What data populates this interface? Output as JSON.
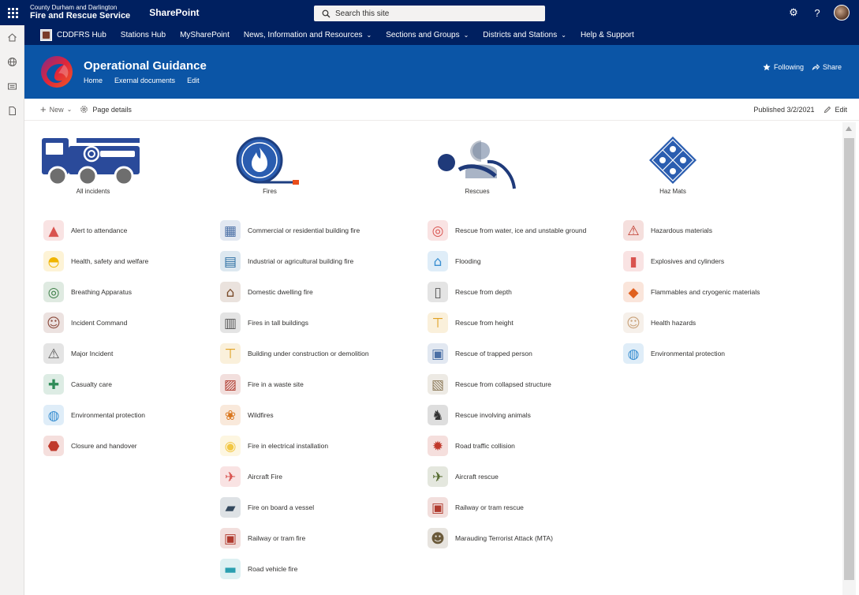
{
  "suite": {
    "org_line1": "County Durham and Darlington",
    "org_line2": "Fire and Rescue Service",
    "app_name": "SharePoint",
    "search_placeholder": "Search this site",
    "settings_glyph": "⚙",
    "help_glyph": "?"
  },
  "hubnav": {
    "items": [
      {
        "label": "CDDFRS Hub",
        "dropdown": false
      },
      {
        "label": "Stations Hub",
        "dropdown": false
      },
      {
        "label": "MySharePoint",
        "dropdown": false
      },
      {
        "label": "News, Information and Resources",
        "dropdown": true
      },
      {
        "label": "Sections and Groups",
        "dropdown": true
      },
      {
        "label": "Districts and Stations",
        "dropdown": true
      },
      {
        "label": "Help & Support",
        "dropdown": false
      }
    ]
  },
  "site": {
    "title": "Operational Guidance",
    "links": [
      "Home",
      "Exernal documents",
      "Edit"
    ],
    "following_label": "Following",
    "share_label": "Share"
  },
  "commandbar": {
    "new_label": "New",
    "page_details_label": "Page details",
    "published_label": "Published 3/2/2021",
    "edit_label": "Edit"
  },
  "columns": [
    {
      "heading": "All incidents",
      "heading_icon": "fire-engine-icon",
      "items": [
        {
          "label": "Alert to attendance",
          "icon": "alarm-light-icon"
        },
        {
          "label": "Health, safety and welfare",
          "icon": "hard-hat-icon"
        },
        {
          "label": "Breathing Apparatus",
          "icon": "gas-mask-icon"
        },
        {
          "label": "Incident Command",
          "icon": "team-icon"
        },
        {
          "label": "Major Incident",
          "icon": "city-alert-icon"
        },
        {
          "label": "Casualty care",
          "icon": "first-aid-icon"
        },
        {
          "label": "Environmental protection",
          "icon": "globe-hands-icon"
        },
        {
          "label": "Closure and handover",
          "icon": "stop-sign-icon"
        }
      ]
    },
    {
      "heading": "Fires",
      "heading_icon": "flame-hose-icon",
      "items": [
        {
          "label": "Commercial or residential building fire",
          "icon": "buildings-icon"
        },
        {
          "label": "Industrial or agricultural building fire",
          "icon": "factory-icon"
        },
        {
          "label": "Domestic dwelling fire",
          "icon": "house-icon"
        },
        {
          "label": "Fires in tall buildings",
          "icon": "tower-block-icon"
        },
        {
          "label": "Building under construction or demolition",
          "icon": "construction-crane-icon"
        },
        {
          "label": "Fire in a waste site",
          "icon": "waste-site-icon"
        },
        {
          "label": "Wildfires",
          "icon": "wildfire-tree-icon"
        },
        {
          "label": "Fire in electrical installation",
          "icon": "light-bulb-icon"
        },
        {
          "label": "Aircraft Fire",
          "icon": "aircraft-icon"
        },
        {
          "label": "Fire on board a vessel",
          "icon": "ship-icon"
        },
        {
          "label": "Railway or tram fire",
          "icon": "train-icon"
        },
        {
          "label": "Road vehicle fire",
          "icon": "car-icon"
        }
      ]
    },
    {
      "heading": "Rescues",
      "heading_icon": "rescuer-icon",
      "items": [
        {
          "label": "Rescue from water, ice and unstable ground",
          "icon": "lifebuoy-icon"
        },
        {
          "label": "Flooding",
          "icon": "flooded-house-icon"
        },
        {
          "label": "Rescue from depth",
          "icon": "depth-shaft-icon"
        },
        {
          "label": "Rescue from height",
          "icon": "tower-crane-icon"
        },
        {
          "label": "Rescue of trapped person",
          "icon": "trapped-person-icon"
        },
        {
          "label": "Rescue from collapsed structure",
          "icon": "collapsed-building-icon"
        },
        {
          "label": "Rescue involving animals",
          "icon": "horse-icon"
        },
        {
          "label": "Road traffic collision",
          "icon": "car-crash-icon"
        },
        {
          "label": "Aircraft rescue",
          "icon": "jet-icon"
        },
        {
          "label": "Railway or tram rescue",
          "icon": "tram-icon"
        },
        {
          "label": "Marauding Terrorist Attack (MTA)",
          "icon": "armed-soldier-icon"
        }
      ]
    },
    {
      "heading": "Haz Mats",
      "heading_icon": "hazard-diamond-icon",
      "items": [
        {
          "label": "Hazardous materials",
          "icon": "hazard-triangle-icon"
        },
        {
          "label": "Explosives and cylinders",
          "icon": "gas-cylinders-icon"
        },
        {
          "label": "Flammables and cryogenic materials",
          "icon": "flammable-diamond-icon"
        },
        {
          "label": "Health hazards",
          "icon": "face-mask-icon"
        },
        {
          "label": "Environmental protection",
          "icon": "globe-hands-icon"
        }
      ]
    }
  ]
}
